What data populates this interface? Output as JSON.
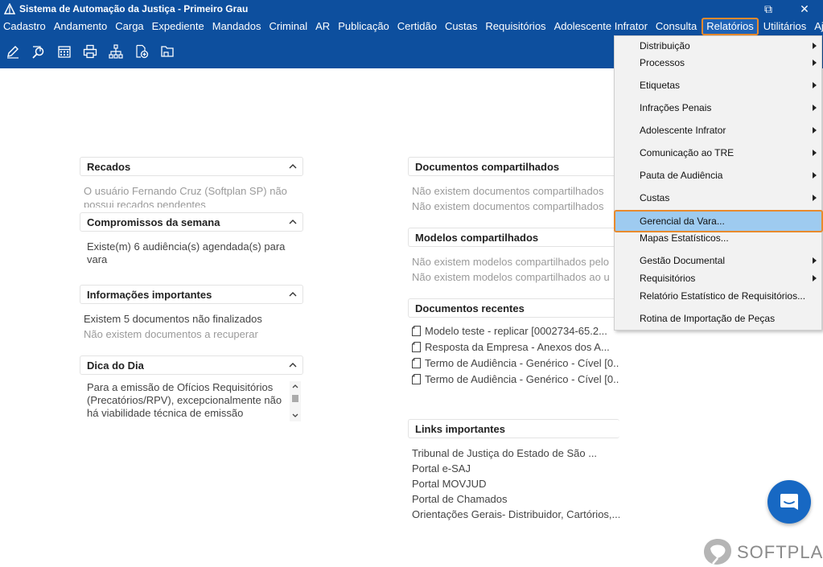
{
  "window": {
    "title": "Sistema de Automação da Justiça - Primeiro Grau",
    "restore_glyph": "⧉",
    "close_glyph": "✕"
  },
  "menubar": [
    "Cadastro",
    "Andamento",
    "Carga",
    "Expediente",
    "Mandados",
    "Criminal",
    "AR",
    "Publicação",
    "Certidão",
    "Custas",
    "Requisitórios",
    "Adolescente Infrator",
    "Consulta",
    "Relatórios",
    "Utilitários",
    "Ajuda"
  ],
  "toolbar_icons": [
    "edit-icon",
    "search-icon",
    "calendar-icon",
    "printer-icon",
    "hierarchy-icon",
    "add-document-icon",
    "folder-icon"
  ],
  "left_panels": {
    "recados": {
      "title": "Recados",
      "text1": "O usuário Fernando Cruz (Softplan SP) não",
      "text2": "possui recados pendentes"
    },
    "compromissos": {
      "title": "Compromissos da semana",
      "text1": "Existe(m) 6 audiência(s) agendada(s) para",
      "text2": "vara"
    },
    "informacoes": {
      "title": "Informações importantes",
      "text1": "Existem 5 documentos não finalizados",
      "text2": "Não existem documentos a recuperar"
    },
    "dica": {
      "title": "Dica do Dia",
      "text": "Para a emissão de Ofícios Requisitórios (Precatórios/RPV), excepcionalmente não há viabilidade técnica de emissão"
    }
  },
  "right_panels": {
    "compartilhados": {
      "title": "Documentos compartilhados",
      "text1": "Não existem documentos compartilhados",
      "text2": "Não existem documentos compartilhados"
    },
    "modelos": {
      "title": "Modelos compartilhados",
      "text1": "Não existem modelos compartilhados pelo",
      "text2": "Não existem modelos compartilhados ao u"
    },
    "recentes": {
      "title": "Documentos recentes",
      "items": [
        "Modelo teste - replicar [0002734-65.2...",
        "Resposta da Empresa -  Anexos dos A...",
        "Termo de Audiência - Genérico - Cível [0...",
        "Termo de Audiência - Genérico - Cível [0..."
      ]
    },
    "links": {
      "title": "Links importantes",
      "items": [
        "Tribunal de Justiça do Estado de São ...",
        "Portal e-SAJ",
        "Portal MOVJUD",
        "Portal de Chamados",
        "Orientações Gerais- Distribuidor, Cartórios,..."
      ]
    }
  },
  "dropdown": {
    "items": [
      {
        "label": "Distribuição",
        "submenu": true
      },
      {
        "label": "Processos",
        "submenu": true
      },
      {
        "label": "Etiquetas",
        "submenu": true
      },
      {
        "label": "Infrações Penais",
        "submenu": true
      },
      {
        "label": "Adolescente Infrator",
        "submenu": true
      },
      {
        "label": "Comunicação ao TRE",
        "submenu": true
      },
      {
        "label": "Pauta de Audiência",
        "submenu": true
      },
      {
        "label": "Custas",
        "submenu": true
      },
      {
        "label": "Gerencial da Vara...",
        "submenu": false,
        "highlighted": true
      },
      {
        "label": "Mapas Estatísticos...",
        "submenu": false
      },
      {
        "label": "Gestão Documental",
        "submenu": true
      },
      {
        "label": "Requisitórios",
        "submenu": true
      },
      {
        "label": "Relatório Estatístico de Requisitórios...",
        "submenu": false
      },
      {
        "label": "Rotina de Importação de Peças",
        "submenu": false
      }
    ]
  },
  "brand": {
    "name": "SOFTPLAN"
  },
  "colors": {
    "topbar": "#0d4f9e",
    "highlight_border": "#e88a2d",
    "highlight_fill": "#9ecbf0",
    "chat_button": "#1768c3"
  }
}
